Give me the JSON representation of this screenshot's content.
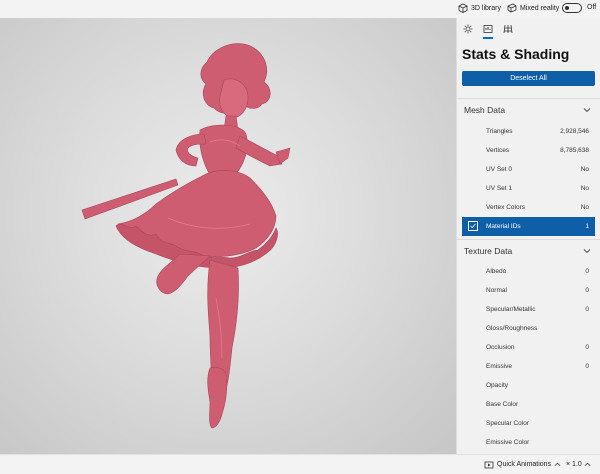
{
  "topbar": {
    "library_label": "3D library",
    "mixed_reality_label": "Mixed reality",
    "toggle_state": "Off"
  },
  "panel": {
    "tabs": [
      {
        "name": "lighting-icon",
        "active": false
      },
      {
        "name": "stats-icon",
        "active": true
      },
      {
        "name": "grid-icon",
        "active": false
      }
    ],
    "title": "Stats & Shading",
    "deselect_label": "Deselect All",
    "mesh": {
      "heading": "Mesh Data",
      "rows": [
        {
          "label": "Triangles",
          "value": "2,928,546"
        },
        {
          "label": "Vertices",
          "value": "8,785,638"
        },
        {
          "label": "UV Set 0",
          "value": "No"
        },
        {
          "label": "UV Set 1",
          "value": "No"
        },
        {
          "label": "Vertex Colors",
          "value": "No"
        },
        {
          "label": "Material IDs",
          "value": "1",
          "selected": true
        }
      ]
    },
    "texture": {
      "heading": "Texture Data",
      "rows": [
        {
          "label": "Albedo",
          "value": "0"
        },
        {
          "label": "Normal",
          "value": "0"
        },
        {
          "label": "Specular/Metallic",
          "value": "0"
        },
        {
          "label": "Gloss/Roughness",
          "value": ""
        },
        {
          "label": "Occlusion",
          "value": "0"
        },
        {
          "label": "Emissive",
          "value": "0"
        },
        {
          "label": "Opacity",
          "value": ""
        },
        {
          "label": "Base Color",
          "value": ""
        },
        {
          "label": "Specular Color",
          "value": ""
        },
        {
          "label": "Emissive Color",
          "value": ""
        }
      ]
    }
  },
  "bottombar": {
    "animations_label": "Quick Animations",
    "speed_label": "× 1.0"
  },
  "colors": {
    "accent": "#0f5ea8",
    "model": "#cf5d72"
  }
}
